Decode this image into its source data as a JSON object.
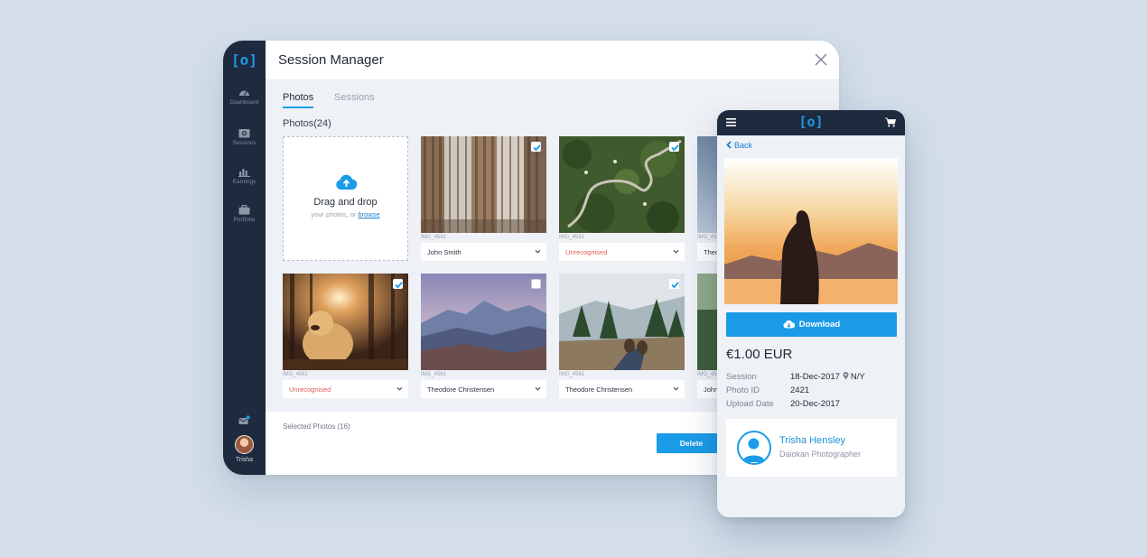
{
  "app": {
    "window_title": "Session Manager",
    "logo_text": "[o]"
  },
  "sidebar": {
    "items": [
      {
        "label": "Dashboard",
        "icon": "dashboard-icon"
      },
      {
        "label": "Sessions",
        "icon": "sessions-icon"
      },
      {
        "label": "Earnings",
        "icon": "earnings-icon"
      },
      {
        "label": "Portfolio",
        "icon": "portfolio-icon"
      }
    ],
    "user_name": "Trisha"
  },
  "tabs": [
    {
      "label": "Photos",
      "active": true
    },
    {
      "label": "Sessions",
      "active": false
    }
  ],
  "photos_heading": "Photos(24)",
  "dropzone": {
    "title": "Drag and drop",
    "subtitle": "your photos, or",
    "link": "browse"
  },
  "photos": [
    {
      "filename": "IMG_4561",
      "assignee": "John Smith",
      "checked": true,
      "scene": "buildings"
    },
    {
      "filename": "IMG_4561",
      "assignee": "Unrecognised",
      "checked": true,
      "scene": "aerial-road"
    },
    {
      "filename": "IMG_4561",
      "assignee": "Theo",
      "checked": false,
      "scene": "sky"
    },
    {
      "filename": "IMG_4561",
      "assignee": "Unrecognised",
      "checked": true,
      "scene": "dog"
    },
    {
      "filename": "IMG_4561",
      "assignee": "Theodore Christensen",
      "checked": false,
      "scene": "mountains"
    },
    {
      "filename": "IMG_4561",
      "assignee": "Theodore Christensen",
      "checked": true,
      "scene": "hiker"
    },
    {
      "filename": "IMG_4561",
      "assignee": "John",
      "checked": false,
      "scene": "forest"
    }
  ],
  "footer": {
    "selected_text": "Selected Photos (16)",
    "delete_label": "Delete"
  },
  "mobile": {
    "logo_text": "[o]",
    "back_label": "Back",
    "download_label": "Download",
    "price": "€1.00 EUR",
    "details": [
      {
        "key": "Session",
        "value": "18-Dec-2017",
        "location": "N/Y"
      },
      {
        "key": "Photo ID",
        "value": "2421"
      },
      {
        "key": "Upload Date",
        "value": "20-Dec-2017"
      }
    ],
    "photographer": {
      "name": "Trisha Hensley",
      "role": "Daiokan Photographer"
    }
  },
  "colors": {
    "accent": "#1a9be8",
    "sidebar": "#1e2a3d",
    "warning": "#e45a5a",
    "background": "#d3deea"
  }
}
